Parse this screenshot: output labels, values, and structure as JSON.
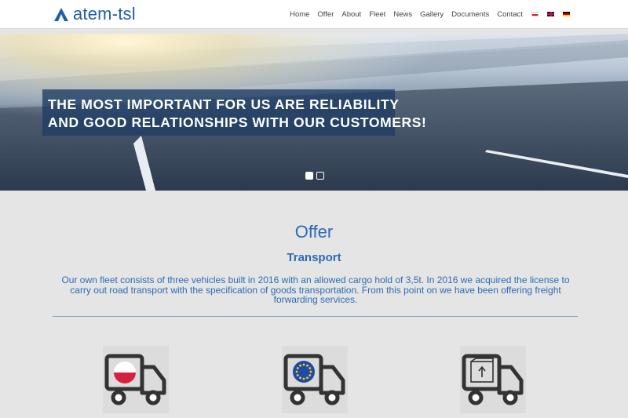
{
  "header": {
    "logo_text": "atem-tsl",
    "nav": [
      "Home",
      "Offer",
      "About",
      "Fleet",
      "News",
      "Gallery",
      "Documents",
      "Contact"
    ],
    "flags": [
      "pl-flag-icon",
      "gb-flag-icon",
      "de-flag-icon"
    ]
  },
  "hero": {
    "line1": "THE MOST IMPORTANT FOR US ARE RELIABILITY",
    "line2": "AND GOOD RELATIONSHIPS WITH OUR CUSTOMERS!",
    "slides": 2,
    "active_slide": 1
  },
  "offer": {
    "title": "Offer",
    "subtitle": "Transport",
    "description": "Our own fleet consists of three vehicles built in 2016 with an allowed cargo hold of 3,5t. In 2016 we acquired the license to carry out road transport with the specification of goods transportation. From this point on we have been offering freight forwarding services."
  },
  "tiles": [
    "truck-poland-icon",
    "truck-eu-icon",
    "truck-cargo-box-icon"
  ],
  "colors": {
    "accent": "#2d6bb3",
    "background": "#e5e5e5",
    "slogan_bg": "#1e3c64"
  }
}
